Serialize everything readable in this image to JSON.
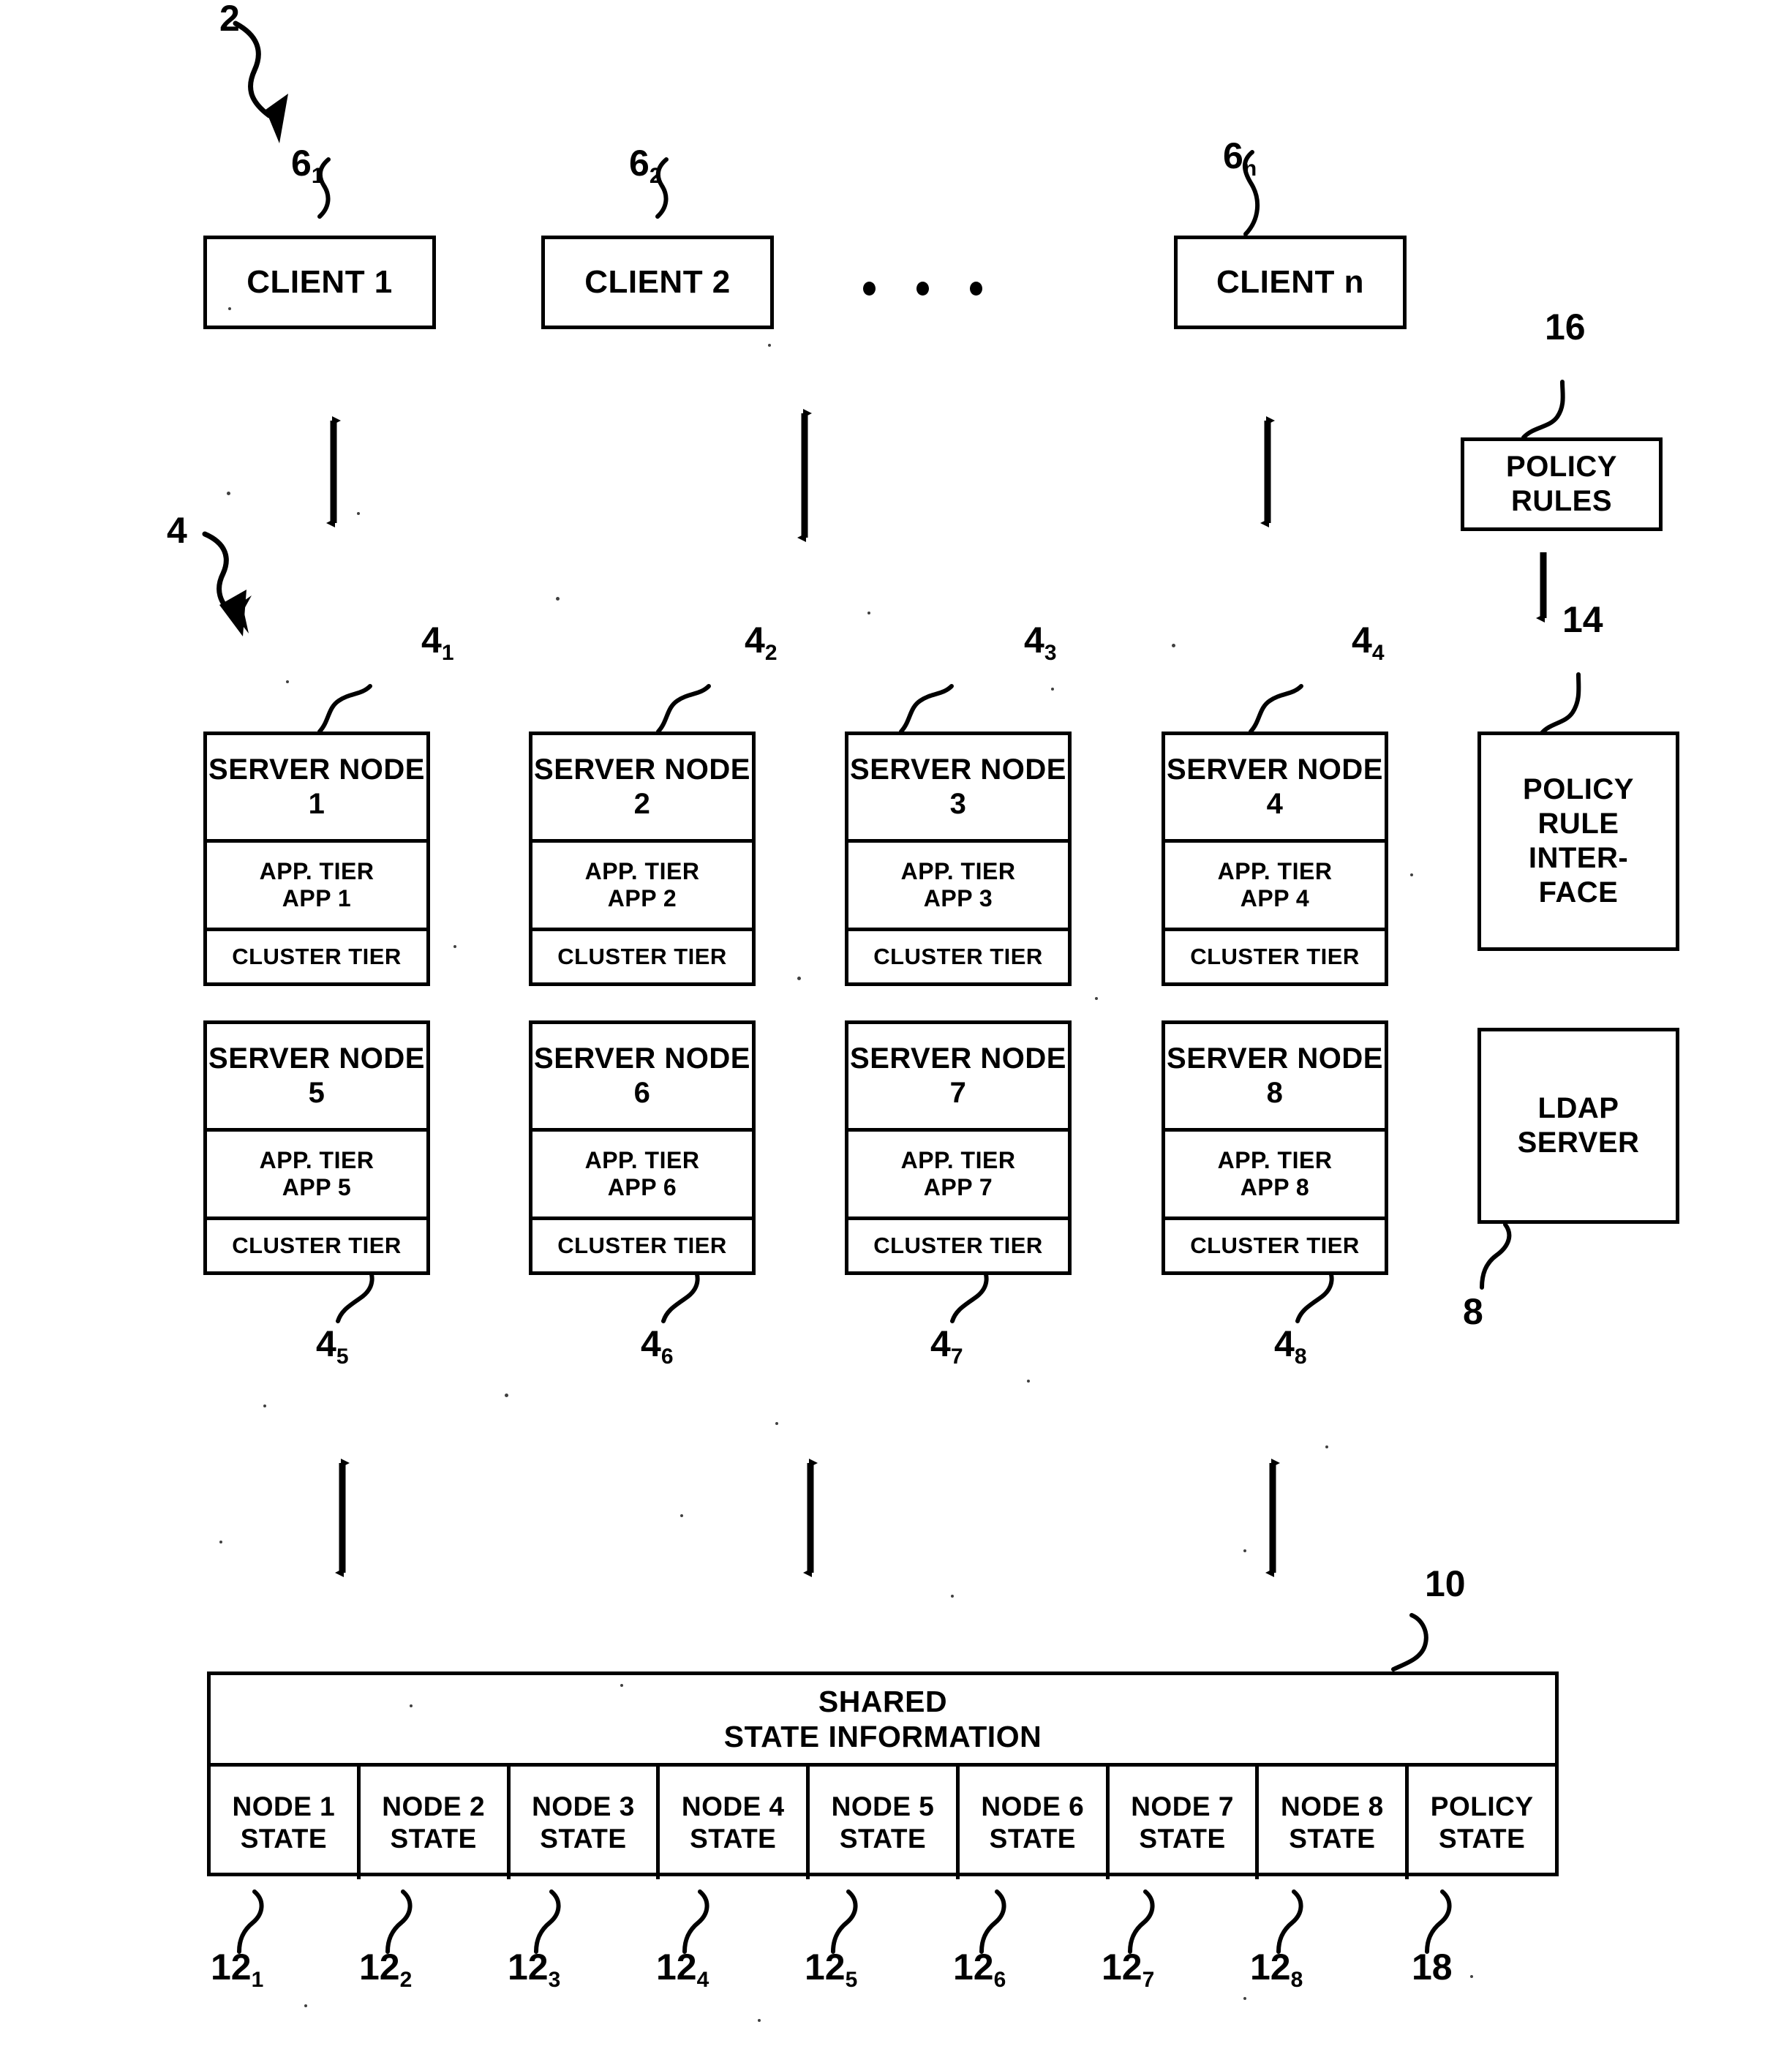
{
  "figure": {
    "system_ref": "2",
    "cluster_ref": "4",
    "ellipsis": "• • •"
  },
  "clients": {
    "items": [
      {
        "label": "CLIENT 1",
        "ref": "6",
        "sub": "1"
      },
      {
        "label": "CLIENT 2",
        "ref": "6",
        "sub": "2"
      },
      {
        "label": "CLIENT n",
        "ref": "6",
        "sub": "n"
      }
    ]
  },
  "server_nodes": {
    "row1": [
      {
        "title": "SERVER NODE 1",
        "app_tier": "APP. TIER",
        "app": "APP 1",
        "cluster_tier": "CLUSTER TIER",
        "ref": "4",
        "sub": "1"
      },
      {
        "title": "SERVER NODE 2",
        "app_tier": "APP. TIER",
        "app": "APP 2",
        "cluster_tier": "CLUSTER TIER",
        "ref": "4",
        "sub": "2"
      },
      {
        "title": "SERVER NODE 3",
        "app_tier": "APP. TIER",
        "app": "APP 3",
        "cluster_tier": "CLUSTER TIER",
        "ref": "4",
        "sub": "3"
      },
      {
        "title": "SERVER NODE 4",
        "app_tier": "APP. TIER",
        "app": "APP 4",
        "cluster_tier": "CLUSTER TIER",
        "ref": "4",
        "sub": "4"
      }
    ],
    "row2": [
      {
        "title": "SERVER NODE 5",
        "app_tier": "APP. TIER",
        "app": "APP 5",
        "cluster_tier": "CLUSTER TIER",
        "ref": "4",
        "sub": "5"
      },
      {
        "title": "SERVER NODE 6",
        "app_tier": "APP. TIER",
        "app": "APP 6",
        "cluster_tier": "CLUSTER TIER",
        "ref": "4",
        "sub": "6"
      },
      {
        "title": "SERVER NODE 7",
        "app_tier": "APP. TIER",
        "app": "APP 7",
        "cluster_tier": "CLUSTER TIER",
        "ref": "4",
        "sub": "7"
      },
      {
        "title": "SERVER NODE 8",
        "app_tier": "APP. TIER",
        "app": "APP 8",
        "cluster_tier": "CLUSTER TIER",
        "ref": "4",
        "sub": "8"
      }
    ]
  },
  "policy": {
    "rules_box": {
      "line1": "POLICY",
      "line2": "RULES",
      "ref": "16"
    },
    "rule_interface_box": {
      "line1": "POLICY",
      "line2": "RULE",
      "line3": "INTER-",
      "line4": "FACE",
      "ref": "14"
    }
  },
  "ldap": {
    "line1": "LDAP",
    "line2": "SERVER",
    "ref": "8"
  },
  "shared_state": {
    "title_line1": "SHARED",
    "title_line2": "STATE INFORMATION",
    "ref": "10",
    "cells": [
      {
        "line1": "NODE 1",
        "line2": "STATE",
        "ref": "12",
        "sub": "1"
      },
      {
        "line1": "NODE 2",
        "line2": "STATE",
        "ref": "12",
        "sub": "2"
      },
      {
        "line1": "NODE 3",
        "line2": "STATE",
        "ref": "12",
        "sub": "3"
      },
      {
        "line1": "NODE 4",
        "line2": "STATE",
        "ref": "12",
        "sub": "4"
      },
      {
        "line1": "NODE 5",
        "line2": "STATE",
        "ref": "12",
        "sub": "5"
      },
      {
        "line1": "NODE 6",
        "line2": "STATE",
        "ref": "12",
        "sub": "6"
      },
      {
        "line1": "NODE 7",
        "line2": "STATE",
        "ref": "12",
        "sub": "7"
      },
      {
        "line1": "NODE 8",
        "line2": "STATE",
        "ref": "12",
        "sub": "8"
      },
      {
        "line1": "POLICY",
        "line2": "STATE",
        "ref": "18",
        "sub": ""
      }
    ]
  }
}
